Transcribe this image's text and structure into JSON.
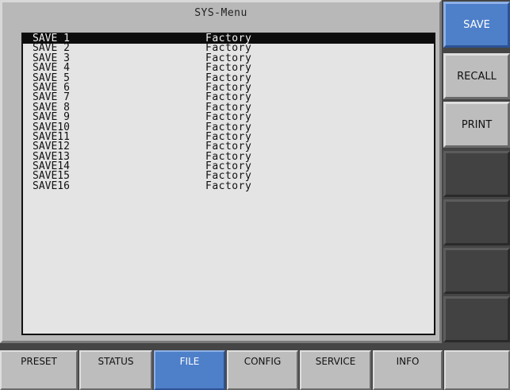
{
  "title": "SYS-Menu",
  "list": {
    "rows": [
      {
        "name": "SAVE 1",
        "value": "Factory",
        "selected": true
      },
      {
        "name": "SAVE 2",
        "value": "Factory"
      },
      {
        "name": "SAVE 3",
        "value": "Factory"
      },
      {
        "name": "SAVE 4",
        "value": "Factory"
      },
      {
        "name": "SAVE 5",
        "value": "Factory"
      },
      {
        "name": "SAVE 6",
        "value": "Factory"
      },
      {
        "name": "SAVE 7",
        "value": "Factory"
      },
      {
        "name": "SAVE 8",
        "value": "Factory"
      },
      {
        "name": "SAVE 9",
        "value": "Factory"
      },
      {
        "name": "SAVE10",
        "value": "Factory"
      },
      {
        "name": "SAVE11",
        "value": "Factory"
      },
      {
        "name": "SAVE12",
        "value": "Factory"
      },
      {
        "name": "SAVE13",
        "value": "Factory"
      },
      {
        "name": "SAVE14",
        "value": "Factory"
      },
      {
        "name": "SAVE15",
        "value": "Factory"
      },
      {
        "name": "SAVE16",
        "value": "Factory"
      }
    ]
  },
  "softkeys": {
    "save": "SAVE",
    "recall": "RECALL",
    "print": "PRINT"
  },
  "tabs": {
    "preset": "PRESET",
    "status": "STATUS",
    "file": "FILE",
    "config": "CONFIG",
    "service": "SERVICE",
    "info": "INFO"
  },
  "colors": {
    "accent": "#4e7fc9",
    "panel": "#b8b8b8",
    "list_background": "#e4e4e4",
    "selection": "#0c0c0c"
  }
}
